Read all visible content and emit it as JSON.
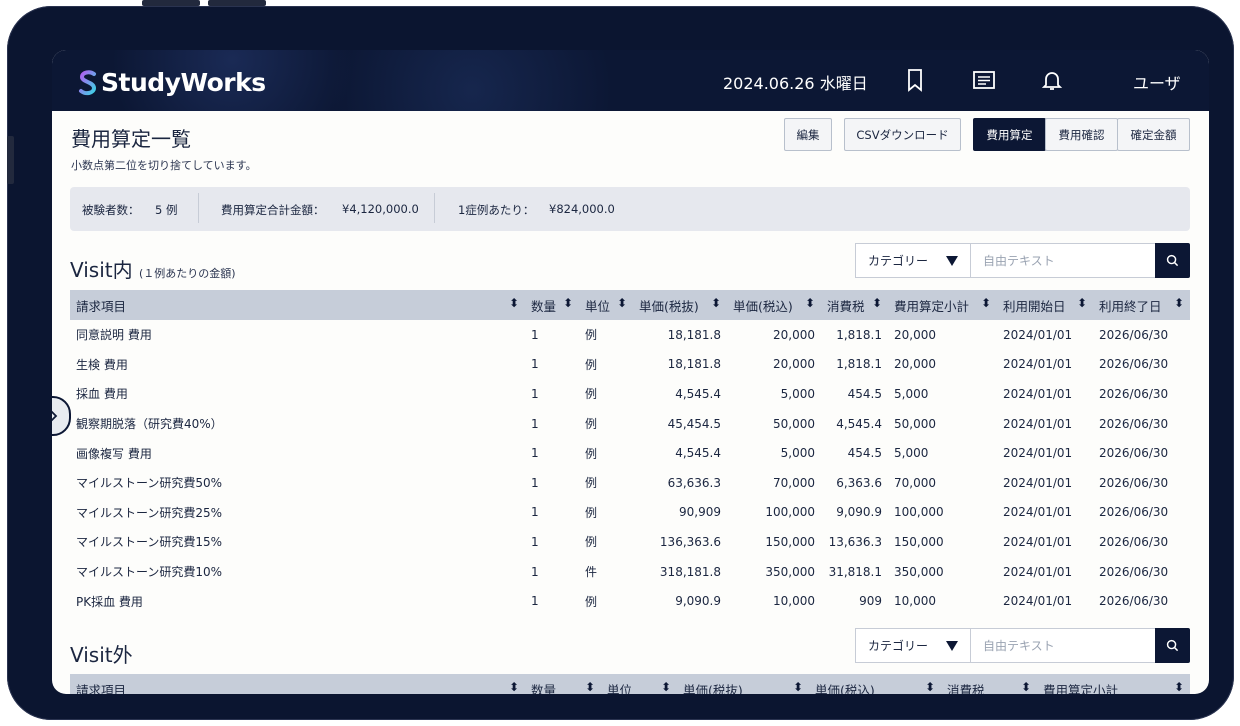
{
  "app": {
    "logo_text": "StudyWorks",
    "date": "2024.06.26 水曜日",
    "user": "ユーザ"
  },
  "page": {
    "title": "費用算定一覧",
    "note": "小数点第二位を切り捨てしています。"
  },
  "toolbar": {
    "edit": "編集",
    "csv": "CSVダウンロード",
    "calc": "費用算定",
    "confirm": "費用確認",
    "final": "確定金額"
  },
  "summary": {
    "subjects_label": "被験者数：",
    "subjects_value": "5 例",
    "total_label": "費用算定合計金額：",
    "total_value": "¥4,120,000.0",
    "per_case_label": "1症例あたり：",
    "per_case_value": "¥824,000.0"
  },
  "visit_in": {
    "title": "Visit内",
    "note": "(１例あたりの金額)",
    "filter": {
      "category": "カテゴリー",
      "placeholder": "自由テキスト"
    },
    "columns": [
      "請求項目",
      "数量",
      "単位",
      "単価(税抜)",
      "単価(税込)",
      "消費税",
      "費用算定小計",
      "利用開始日",
      "利用終了日"
    ],
    "rows": [
      [
        "同意説明 費用",
        "1",
        "例",
        "18,181.8",
        "20,000",
        "1,818.1",
        "20,000",
        "2024/01/01",
        "2026/06/30"
      ],
      [
        "生検 費用",
        "1",
        "例",
        "18,181.8",
        "20,000",
        "1,818.1",
        "20,000",
        "2024/01/01",
        "2026/06/30"
      ],
      [
        "採血 費用",
        "1",
        "例",
        "4,545.4",
        "5,000",
        "454.5",
        "5,000",
        "2024/01/01",
        "2026/06/30"
      ],
      [
        "観察期脱落（研究費40%）",
        "1",
        "例",
        "45,454.5",
        "50,000",
        "4,545.4",
        "50,000",
        "2024/01/01",
        "2026/06/30"
      ],
      [
        "画像複写 費用",
        "1",
        "例",
        "4,545.4",
        "5,000",
        "454.5",
        "5,000",
        "2024/01/01",
        "2026/06/30"
      ],
      [
        "マイルストーン研究費50%",
        "1",
        "例",
        "63,636.3",
        "70,000",
        "6,363.6",
        "70,000",
        "2024/01/01",
        "2026/06/30"
      ],
      [
        "マイルストーン研究費25%",
        "1",
        "例",
        "90,909",
        "100,000",
        "9,090.9",
        "100,000",
        "2024/01/01",
        "2026/06/30"
      ],
      [
        "マイルストーン研究費15%",
        "1",
        "例",
        "136,363.6",
        "150,000",
        "13,636.3",
        "150,000",
        "2024/01/01",
        "2026/06/30"
      ],
      [
        "マイルストーン研究費10%",
        "1",
        "件",
        "318,181.8",
        "350,000",
        "31,818.1",
        "350,000",
        "2024/01/01",
        "2026/06/30"
      ],
      [
        "PK採血 費用",
        "1",
        "例",
        "9,090.9",
        "10,000",
        "909",
        "10,000",
        "2024/01/01",
        "2026/06/30"
      ]
    ]
  },
  "visit_out": {
    "title": "Visit外",
    "filter": {
      "category": "カテゴリー",
      "placeholder": "自由テキスト"
    },
    "columns": [
      "請求項目",
      "数量",
      "単位",
      "単価(税抜)",
      "単価(税込)",
      "消費税",
      "費用算定小計"
    ]
  }
}
